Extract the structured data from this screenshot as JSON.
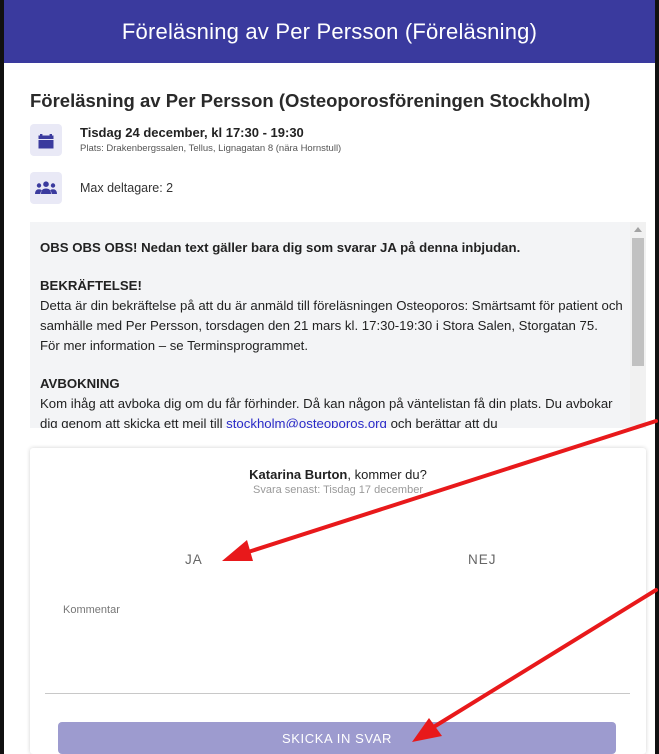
{
  "header": {
    "title": "Föreläsning av Per Persson (Föreläsning)"
  },
  "event": {
    "title": "Föreläsning av Per Persson (Osteoporosföreningen Stockholm)",
    "date_line": "Tisdag 24 december, kl 17:30 - 19:30",
    "place_line": "Plats: Drakenbergssalen, Tellus, Lignagatan 8 (nära Hornstull)",
    "max_participants": "Max deltagare: 2",
    "icons": {
      "calendar": "calendar-icon",
      "people": "people-group-icon"
    },
    "icon_color": "#3a3a9e"
  },
  "description": {
    "notice": "OBS OBS OBS! Nedan text gäller bara dig som svarar JA på denna inbjudan.",
    "confirm_heading": "BEKRÄFTELSE!",
    "confirm_text": "Detta är din bekräftelse på att du är anmäld till föreläsningen Osteoporos: Smärtsamt för patient och samhälle med Per Persson, torsdagen den 21 mars kl. 17:30-19:30 i Stora Salen, Storgatan 75.",
    "more_info": "För mer information – se Terminsprogrammet.",
    "cancel_heading": "AVBOKNING",
    "cancel_text_1": "Kom ihåg att avboka dig om du får förhinder. Då kan någon på väntelistan få din plats. Du avbokar dig genom att skicka ett mejl till ",
    "cancel_email": "stockholm@osteoporos.org",
    "cancel_text_2": " och berättar att du"
  },
  "reply": {
    "invitee_name": "Katarina Burton",
    "invitee_question": ", kommer du?",
    "deadline": "Svara senast: Tisdag 17 december",
    "yes_label": "JA",
    "no_label": "NEJ",
    "comment_placeholder": "Kommentar",
    "submit_label": "SKICKA IN SVAR"
  },
  "colors": {
    "header_bg": "#3a3a9e",
    "submit_bg": "#9d9bcf",
    "annotation_arrow": "#e8191b",
    "link": "#2a2ac8"
  }
}
